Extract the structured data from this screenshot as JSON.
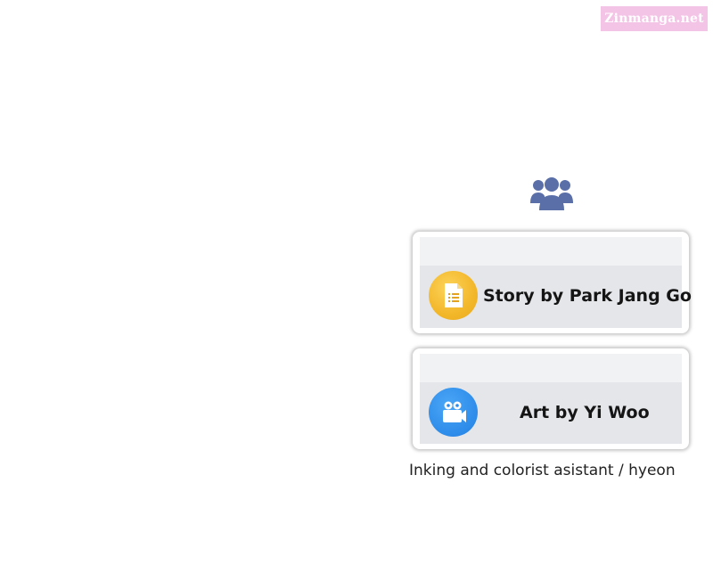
{
  "watermark": {
    "text": "Zinmanga.net",
    "color": "#f4c4e6"
  },
  "header_icon": {
    "name": "users-group-icon",
    "color": "#5a6ea8"
  },
  "credits": [
    {
      "label": "Story by Park Jang Go",
      "icon": "document-icon",
      "icon_color": "#f3b72a"
    },
    {
      "label": "Art by Yi Woo",
      "icon": "video-camera-icon",
      "icon_color": "#2d8bea"
    }
  ],
  "caption": "Inking and colorist asistant / hyeon"
}
